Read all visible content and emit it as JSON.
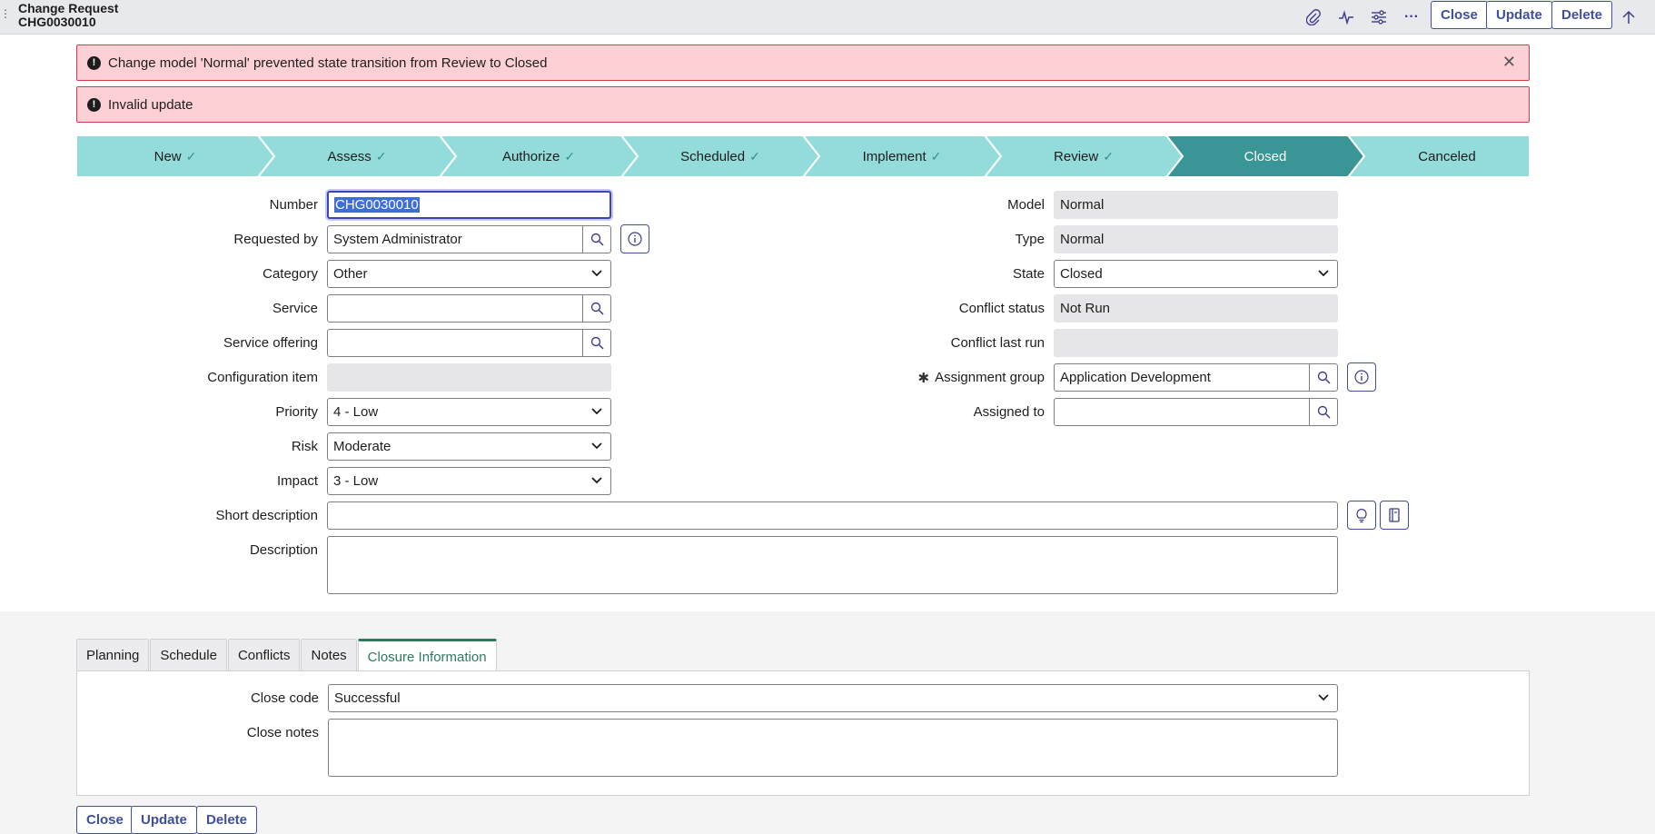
{
  "header": {
    "title": "Change Request",
    "record_number": "CHG0030010",
    "icons": [
      "paperclip-icon",
      "activity-icon",
      "sliders-icon",
      "more-icon",
      "arrow-up-icon"
    ],
    "buttons": {
      "close": "Close",
      "update": "Update",
      "delete": "Delete"
    }
  },
  "alerts": [
    {
      "text": "Change model 'Normal' prevented state transition from Review to Closed",
      "icon": "exclamation-icon",
      "dismissible": true
    },
    {
      "text": "Invalid update",
      "icon": "exclamation-icon",
      "dismissible": false
    }
  ],
  "process_flow": {
    "stages": [
      {
        "label": "New",
        "done": true
      },
      {
        "label": "Assess",
        "done": true
      },
      {
        "label": "Authorize",
        "done": true
      },
      {
        "label": "Scheduled",
        "done": true
      },
      {
        "label": "Implement",
        "done": true
      },
      {
        "label": "Review",
        "done": true
      },
      {
        "label": "Closed",
        "done": false,
        "active": true
      },
      {
        "label": "Canceled",
        "done": false
      }
    ],
    "colors": {
      "stage": "#94dbdb",
      "active": "#3a9597"
    }
  },
  "form": {
    "number": {
      "label": "Number",
      "value": "CHG0030010"
    },
    "requested_by": {
      "label": "Requested by",
      "value": "System Administrator"
    },
    "category": {
      "label": "Category",
      "value": "Other"
    },
    "service": {
      "label": "Service",
      "value": ""
    },
    "service_offering": {
      "label": "Service offering",
      "value": ""
    },
    "configuration_item": {
      "label": "Configuration item",
      "value": ""
    },
    "priority": {
      "label": "Priority",
      "value": "4 - Low"
    },
    "risk": {
      "label": "Risk",
      "value": "Moderate"
    },
    "impact": {
      "label": "Impact",
      "value": "3 - Low"
    },
    "model": {
      "label": "Model",
      "value": "Normal"
    },
    "type": {
      "label": "Type",
      "value": "Normal"
    },
    "state": {
      "label": "State",
      "value": "Closed"
    },
    "conflict_status": {
      "label": "Conflict status",
      "value": "Not Run"
    },
    "conflict_last_run": {
      "label": "Conflict last run",
      "value": ""
    },
    "assignment_group": {
      "label": "Assignment group",
      "value": "Application Development",
      "required_mark": "✱"
    },
    "assigned_to": {
      "label": "Assigned to",
      "value": ""
    },
    "short_description": {
      "label": "Short description",
      "value": ""
    },
    "description": {
      "label": "Description",
      "value": ""
    }
  },
  "tabs": [
    {
      "label": "Planning",
      "active": false
    },
    {
      "label": "Schedule",
      "active": false
    },
    {
      "label": "Conflicts",
      "active": false
    },
    {
      "label": "Notes",
      "active": false
    },
    {
      "label": "Closure Information",
      "active": true
    }
  ],
  "closure": {
    "close_code": {
      "label": "Close code",
      "value": "Successful"
    },
    "close_notes": {
      "label": "Close notes",
      "value": ""
    }
  },
  "footer_buttons": {
    "close": "Close",
    "update": "Update",
    "delete": "Delete"
  }
}
